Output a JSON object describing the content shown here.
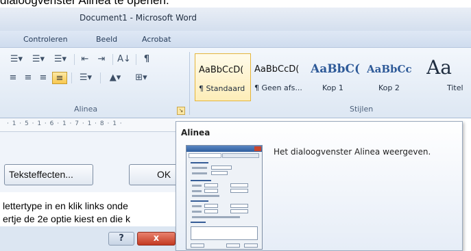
{
  "caption": "dialoogvenster Alinea te openen.",
  "window": {
    "title": "Document1 - Microsoft Word"
  },
  "tabs": [
    "Controleren",
    "Beeld",
    "Acrobat"
  ],
  "paragraph_group": {
    "label": "Alinea",
    "row1": [
      "☰▾",
      "☰▾",
      "☰▾",
      "⇤",
      "⇥",
      "A↓",
      "¶"
    ],
    "row2": [
      "≡",
      "≡",
      "≡",
      "≡",
      "☰▾",
      "▲▾",
      "⊞▾"
    ]
  },
  "styles_group": {
    "label": "Stijlen",
    "items": [
      {
        "sample": "AaBbCcD(",
        "name": "¶ Standaard"
      },
      {
        "sample": "AaBbCcD(",
        "name": "¶ Geen afs..."
      },
      {
        "sample": "AaBbC(",
        "name": "Kop 1"
      },
      {
        "sample": "AaBbCc",
        "name": "Kop 2"
      },
      {
        "sample": "Aa",
        "name": "Titel"
      }
    ]
  },
  "ruler": {
    "text": "· 1 · 5 · 1 · 6 · 1 · 7 · 1 · 8 · 1 ·"
  },
  "dialog": {
    "text_effects_button": "Teksteffecten...",
    "ok_button": "OK",
    "help_button": "?",
    "close_button": "x"
  },
  "document": {
    "line1": "lettertype in en klik links onde",
    "line2": "ertje de  2e optie kiest en die k"
  },
  "tooltip": {
    "title": "Alinea",
    "description": "Het dialoogvenster Alinea weergeven."
  },
  "colors": {
    "ribbon": "#dde7f3",
    "accent": "#2f5e9e",
    "style_headings": "#2e5a98",
    "selected": "#fdedb8"
  },
  "icons": {
    "launcher": "dialog-launcher-icon",
    "thumbnail": "dialog-thumbnail-icon"
  }
}
